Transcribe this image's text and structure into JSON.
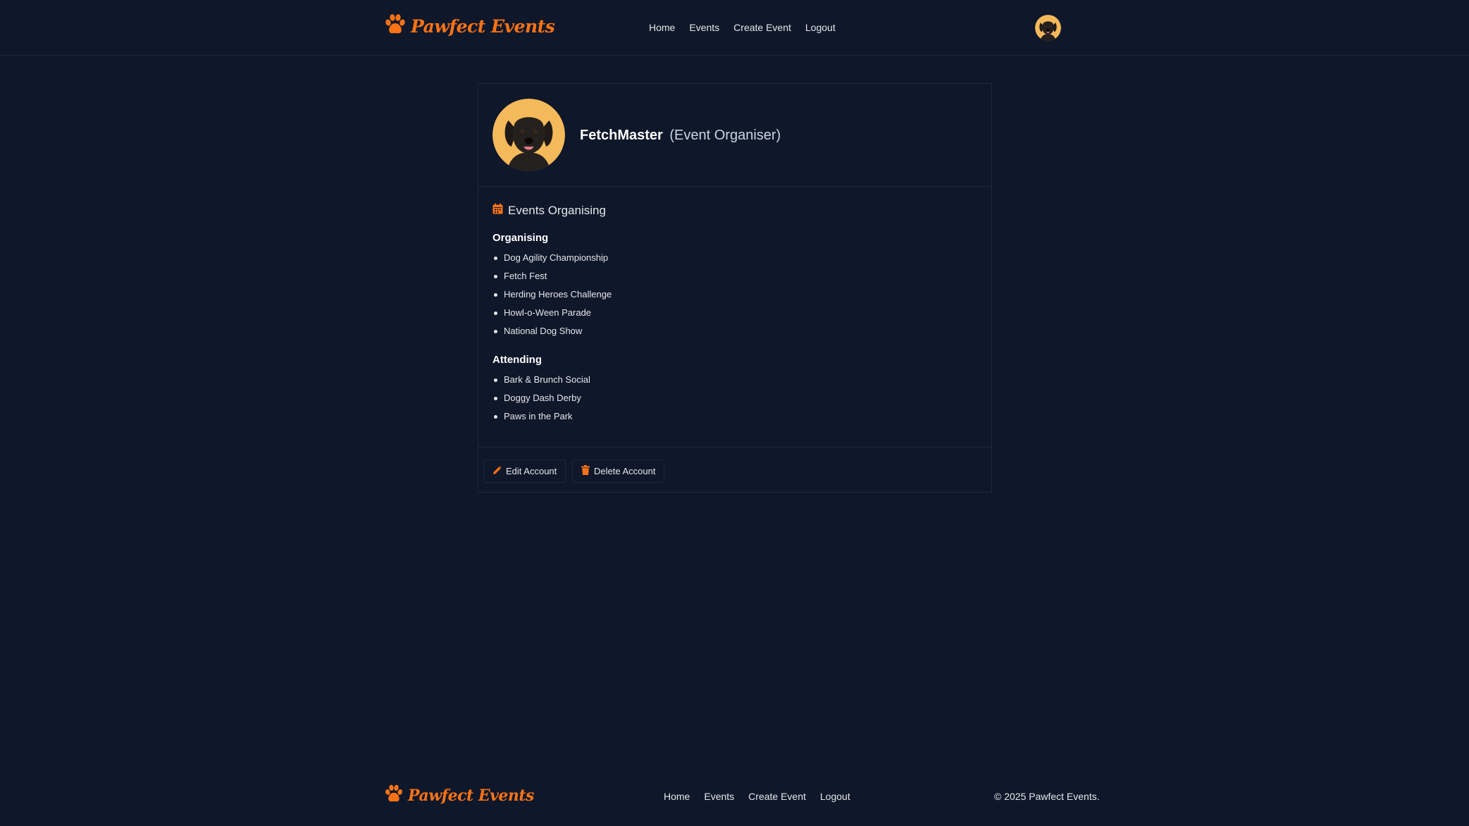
{
  "brand": {
    "name": "Pawfect Events",
    "color": "#f97316"
  },
  "header": {
    "nav": [
      "Home",
      "Events",
      "Create Event",
      "Logout"
    ],
    "avatar_icon": "user-avatar-dog"
  },
  "profile": {
    "username": "FetchMaster",
    "role": "(Event Organiser)",
    "avatar_icon": "dog-avatar"
  },
  "events": {
    "section_title": "Events Organising",
    "section_icon": "calendar-icon",
    "organising": {
      "title": "Organising",
      "items": [
        "Dog Agility Championship",
        "Fetch Fest",
        "Herding Heroes Challenge",
        "Howl-o-Ween Parade",
        "National Dog Show"
      ]
    },
    "attending": {
      "title": "Attending",
      "items": [
        "Bark & Brunch Social",
        "Doggy Dash Derby",
        "Paws in the Park"
      ]
    }
  },
  "actions": {
    "edit_label": "Edit Account",
    "delete_label": "Delete Account"
  },
  "footer": {
    "nav": [
      "Home",
      "Events",
      "Create Event",
      "Logout"
    ],
    "copyright": "© 2025 Pawfect Events."
  },
  "colors": {
    "background": "#0f172a",
    "border": "#1e293b",
    "accent": "#f97316",
    "avatar_bg": "#f4b95a"
  }
}
